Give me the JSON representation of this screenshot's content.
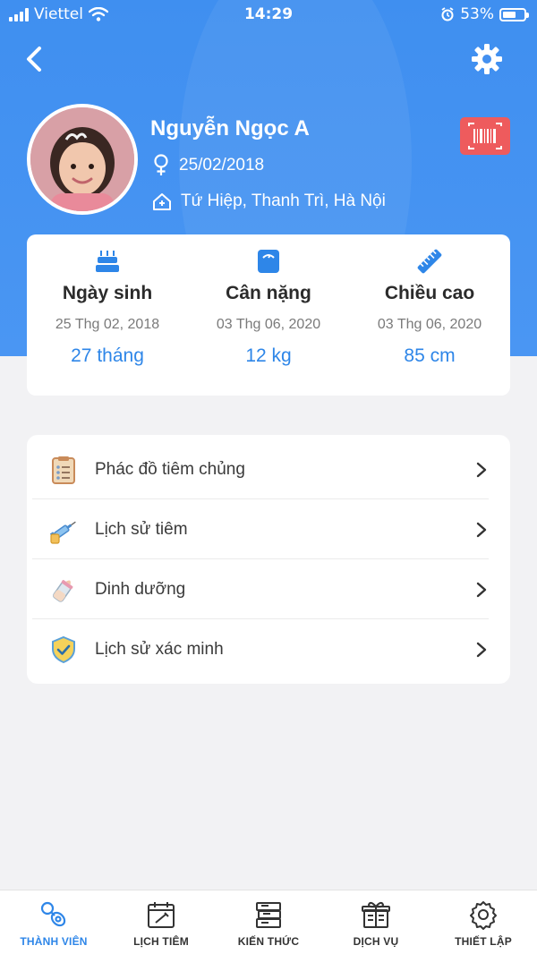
{
  "status_bar": {
    "carrier": "Viettel",
    "time": "14:29",
    "battery": "53%"
  },
  "profile": {
    "name": "Nguyễn Ngọc A",
    "dob": "25/02/2018",
    "address": "Tứ Hiệp, Thanh Trì, Hà Nội"
  },
  "stats": [
    {
      "icon": "cake-icon",
      "label": "Ngày sinh",
      "date": "25 Thg 02, 2018",
      "value": "27 tháng"
    },
    {
      "icon": "scale-icon",
      "label": "Cân nặng",
      "date": "03 Thg 06, 2020",
      "value": "12 kg"
    },
    {
      "icon": "ruler-icon",
      "label": "Chiều cao",
      "date": "03 Thg 06, 2020",
      "value": "85 cm"
    }
  ],
  "menu": [
    {
      "icon": "clipboard-icon",
      "label": "Phác đồ tiêm chủng"
    },
    {
      "icon": "syringe-icon",
      "label": "Lịch sử tiêm"
    },
    {
      "icon": "baby-bottle-icon",
      "label": "Dinh dưỡng"
    },
    {
      "icon": "verified-shield-icon",
      "label": "Lịch sử xác minh"
    }
  ],
  "tabs": [
    {
      "icon": "pacifier-icon",
      "label": "THÀNH VIÊN",
      "active": true
    },
    {
      "icon": "calendar-icon",
      "label": "LỊCH TIÊM",
      "active": false
    },
    {
      "icon": "books-icon",
      "label": "KIẾN THỨC",
      "active": false
    },
    {
      "icon": "gift-icon",
      "label": "DỊCH VỤ",
      "active": false
    },
    {
      "icon": "gear-icon",
      "label": "THIẾT LẬP",
      "active": false
    }
  ],
  "colors": {
    "header": "#3f8ff0",
    "accent": "#2e86e8",
    "barcode_button": "#ee5b5d",
    "background": "#f2f2f4"
  }
}
